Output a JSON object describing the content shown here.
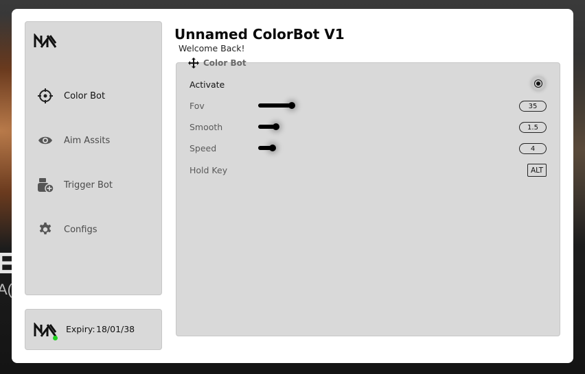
{
  "app": {
    "title": "Unnamed ColorBot V1",
    "welcome": "Welcome Back!"
  },
  "background": {
    "big_letter": "E",
    "small_text": "A("
  },
  "sidebar": {
    "items": [
      {
        "label": "Color Bot",
        "icon": "crosshair-icon",
        "active": true
      },
      {
        "label": "Aim Assits",
        "icon": "eye-icon",
        "active": false
      },
      {
        "label": "Trigger Bot",
        "icon": "trigger-add-icon",
        "active": false
      },
      {
        "label": "Configs",
        "icon": "gear-icon",
        "active": false
      }
    ]
  },
  "footer": {
    "expiry_label": "Expiry:",
    "expiry_value": "18/01/38",
    "status_color": "#1fd11f"
  },
  "panel": {
    "header": "Color Bot",
    "activate": {
      "label": "Activate",
      "checked": true
    },
    "fov": {
      "label": "Fov",
      "value": "35",
      "fraction": 0.38
    },
    "smooth": {
      "label": "Smooth",
      "value": "1.5",
      "fraction": 0.2
    },
    "speed": {
      "label": "Speed",
      "value": "4",
      "fraction": 0.16
    },
    "hold_key": {
      "label": "Hold Key",
      "value": "ALT"
    }
  }
}
